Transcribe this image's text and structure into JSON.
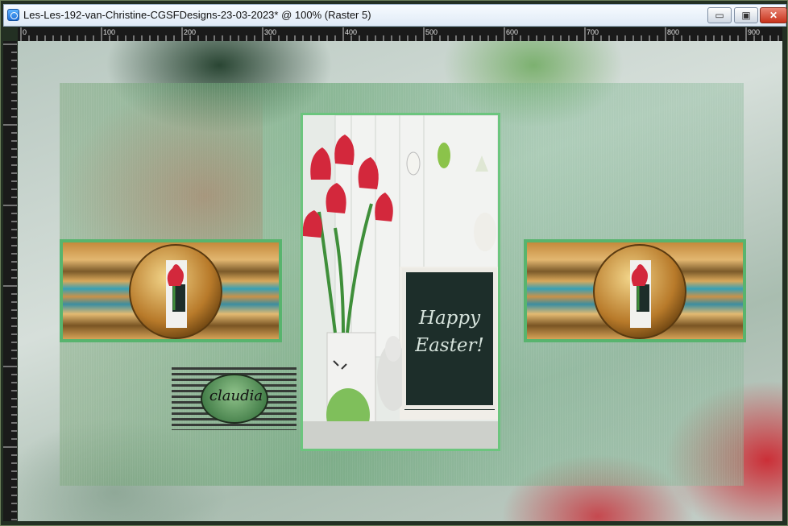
{
  "window": {
    "title": "Les-Les-192-van-Christine-CGSFDesigns-23-03-2023* @ 100% (Raster 5)",
    "app_icon": "paintshop-icon",
    "controls": {
      "minimize": "▭",
      "maximize": "▣",
      "close": "✕"
    }
  },
  "ruler": {
    "labels": [
      "0",
      "100",
      "200",
      "300",
      "400",
      "500",
      "600",
      "700",
      "800",
      "900"
    ]
  },
  "artwork": {
    "watermark_text": "claudia",
    "chalkboard_text_line1": "Happy",
    "chalkboard_text_line2": "Easter!"
  },
  "colors": {
    "frame_green": "#6cc57e",
    "banner_border": "#58b46e",
    "close_red": "#c7331c"
  }
}
